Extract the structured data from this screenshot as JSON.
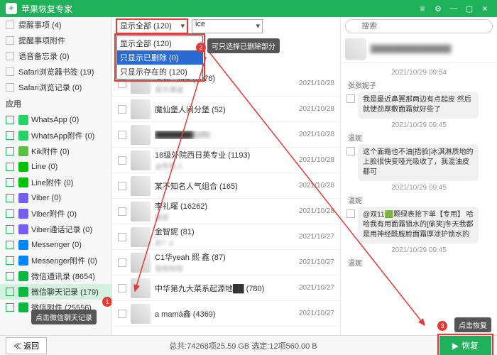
{
  "titlebar": {
    "title": "苹果恢复专家"
  },
  "sidebar": {
    "top_items": [
      {
        "label": "提醒事项 (4)"
      },
      {
        "label": "提醒事项附件"
      },
      {
        "label": "语音备忘录 (0)"
      },
      {
        "label": "Safari浏览器书签 (19)"
      },
      {
        "label": "Safari浏览记录 (0)"
      }
    ],
    "section": "应用",
    "app_items": [
      {
        "icon": "wa",
        "label": "WhatsApp (0)"
      },
      {
        "icon": "wa",
        "label": "WhatsApp附件 (0)"
      },
      {
        "icon": "kik",
        "label": "Kik附件 (0)"
      },
      {
        "icon": "line",
        "label": "Line (0)"
      },
      {
        "icon": "line",
        "label": "Line附件 (0)"
      },
      {
        "icon": "viber",
        "label": "Viber (0)"
      },
      {
        "icon": "viber",
        "label": "Viber附件 (0)"
      },
      {
        "icon": "viber",
        "label": "Viber通话记录 (0)"
      },
      {
        "icon": "msg",
        "label": "Messenger (0)"
      },
      {
        "icon": "msg",
        "label": "Messenger附件 (0)"
      },
      {
        "icon": "wx",
        "label": "微信通讯录 (8654)"
      },
      {
        "icon": "wx",
        "label": "微信聊天记录 (179)",
        "selected": true
      },
      {
        "icon": "wx",
        "label": "微信附件 (25556)"
      }
    ]
  },
  "filters": {
    "select1": "显示全部 (120)",
    "select2": "ice",
    "dropdown": [
      {
        "label": "显示全部 (120)"
      },
      {
        "label": "只显示已删除 (0)",
        "hover": true
      },
      {
        "label": "只显示存在的 (120)"
      }
    ]
  },
  "tooltips": {
    "t1": "点击微信聊天记录",
    "t2": "可只选择已删除部分",
    "t3": "点击恢复"
  },
  "chats": [
    {
      "name": "梦颖—3群 (2076)",
      "sub": "官方满减",
      "date": "2021/10/28"
    },
    {
      "name": "魔仙堡人间分堡 (52)",
      "sub": "",
      "date": "2021/10/28"
    },
    {
      "name": "███████ (15)",
      "sub": "",
      "date": "2021/10/28",
      "blur": true
    },
    {
      "name": "18级外院西日英专业 (1193)",
      "sub": "@所有人",
      "date": "2021/10/28"
    },
    {
      "name": "某不知名人气组合 (165)",
      "sub": "",
      "date": "2021/10/28"
    },
    {
      "name": "李礼曜 (16262)",
      "sub": "晚安",
      "date": "2021/10/28"
    },
    {
      "name": "金智妮 (81)",
      "sub": "好？d",
      "date": "2021/10/27"
    },
    {
      "name": "C1华yeah 熙 鑫 (87)",
      "sub": "哈哈哈哈",
      "date": "2021/10/27"
    },
    {
      "name": "中华第九大菜系起源地██ (780)",
      "sub": "",
      "date": "2021/10/27"
    },
    {
      "name": "a mamá鑫 (4369)",
      "sub": "",
      "date": "2021/10/27"
    }
  ],
  "search_placeholder": "搜索",
  "conversation": {
    "ts1": "2021/10/29 09:54",
    "name1": "张张妮子",
    "msg1": "我是最近鼻翼那两边有点起皮 然后就使劲厚敷面霜就好些了",
    "ts2": "2021/10/29 09:45",
    "name2": "温妮",
    "msg2": "这个面霜也不油[捂脸]冰淇淋质地的 上脸很快变哑光吸收了，我混油皮都可",
    "ts3": "2021/10/29 09:45",
    "name3": "温妮",
    "msg3": "@双11🟩颗绿表抢下单【专用】 哈哈我有用面霜锁水的[偷笑]冬天我都是用神经酰胺脸面霜厚涂护锁水的",
    "ts4": "2021/10/29 09:45",
    "name4": "温妮"
  },
  "footer": {
    "back": "返回",
    "stats": "总共:74268项25.59 GB 选定:12项560.00 B",
    "recover": "恢复"
  }
}
